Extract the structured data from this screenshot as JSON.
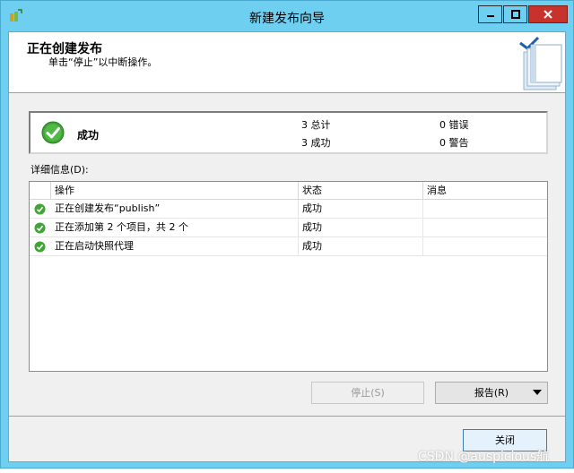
{
  "window": {
    "title": "新建发布向导",
    "controls": {
      "minimize": "minimize-icon",
      "maximize": "maximize-icon",
      "close": "close-icon"
    }
  },
  "header": {
    "title": "正在创建发布",
    "subtitle": "单击“停止”以中断操作。"
  },
  "summary": {
    "status": "成功",
    "total": "3 总计",
    "success": "3 成功",
    "errors": "0 错误",
    "warnings": "0 警告"
  },
  "details": {
    "label": "详细信息(D):",
    "columns": [
      "操作",
      "状态",
      "消息"
    ],
    "rows": [
      {
        "action": "正在创建发布“publish”",
        "status": "成功",
        "message": ""
      },
      {
        "action": "正在添加第 2 个项目，共 2 个",
        "status": "成功",
        "message": ""
      },
      {
        "action": "正在启动快照代理",
        "status": "成功",
        "message": ""
      }
    ]
  },
  "buttons": {
    "stop": "停止(S)",
    "report": "报告(R)",
    "close": "关闭"
  },
  "watermark": "CSDN @auspicious航",
  "colors": {
    "titlebar": "#6fcff0",
    "close_button": "#c7332c",
    "success_green": "#3fa535"
  }
}
